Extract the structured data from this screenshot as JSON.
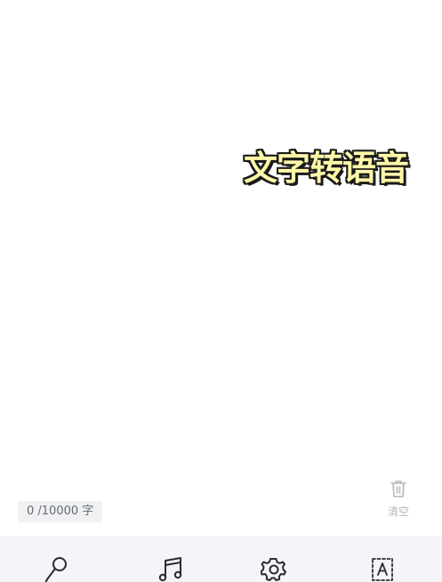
{
  "overlay": {
    "title": "文字转语音"
  },
  "editor": {
    "char_count": "0 /10000 字",
    "clear_label": "清空"
  },
  "icons": {
    "clear": "trash-icon",
    "tabs": [
      "microphone-icon",
      "music-note-icon",
      "gear-icon",
      "text-box-icon"
    ]
  },
  "colors": {
    "title_fill": "#fff8a8",
    "title_outline": "#1a1a1a",
    "bottom_bar": "#f3f5f9",
    "muted_text": "#b4b8be"
  }
}
